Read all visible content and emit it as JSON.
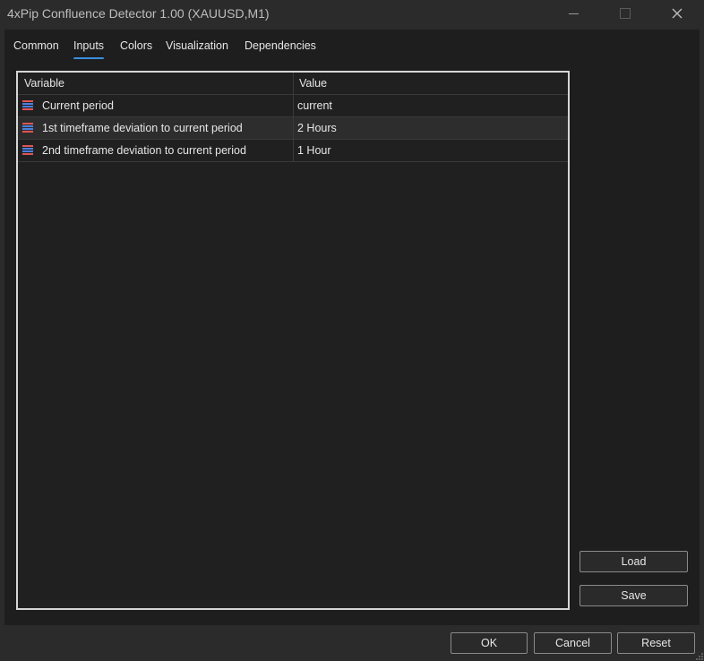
{
  "window": {
    "title": "4xPip Confluence Detector 1.00 (XAUUSD,M1)"
  },
  "tabs": [
    {
      "label": "Common",
      "active": false
    },
    {
      "label": "Inputs",
      "active": true
    },
    {
      "label": "Colors",
      "active": false
    },
    {
      "label": "Visualization",
      "active": false
    },
    {
      "label": "Dependencies",
      "active": false
    }
  ],
  "grid": {
    "headers": {
      "variable": "Variable",
      "value": "Value"
    },
    "rows": [
      {
        "variable": "Current period",
        "value": "current",
        "icon": "enum-icon"
      },
      {
        "variable": "1st timeframe deviation to current period",
        "value": "2 Hours",
        "icon": "enum-icon"
      },
      {
        "variable": "2nd timeframe deviation to current period",
        "value": "1 Hour",
        "icon": "enum-icon"
      }
    ]
  },
  "side_buttons": {
    "load": "Load",
    "save": "Save"
  },
  "footer_buttons": {
    "ok": "OK",
    "cancel": "Cancel",
    "reset": "Reset"
  },
  "colors": {
    "accent": "#3b8ee0",
    "panel": "#1e1e1e",
    "background": "#2b2b2b"
  }
}
